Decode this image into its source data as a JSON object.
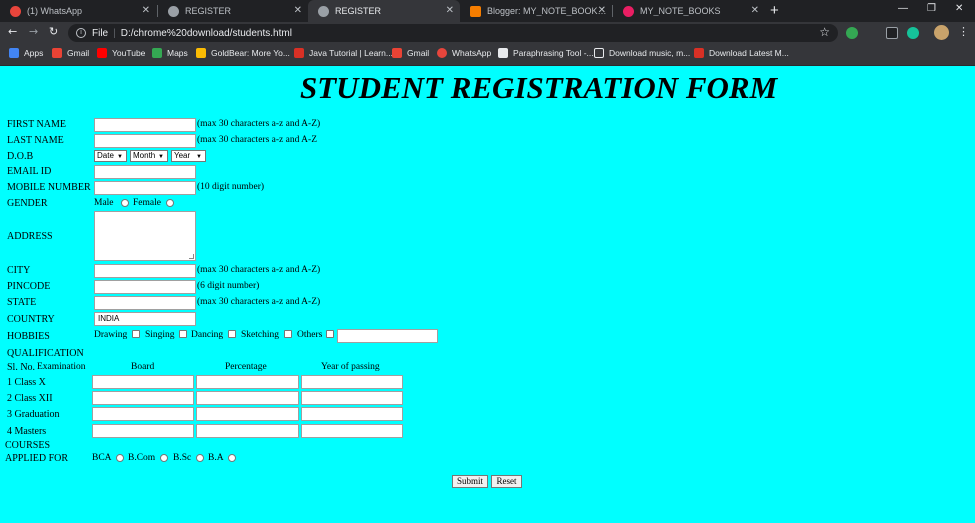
{
  "browser": {
    "tabs": [
      {
        "label": "(1) WhatsApp",
        "color": "#e8453c"
      },
      {
        "label": "REGISTER",
        "color": "#9aa0a6"
      },
      {
        "label": "REGISTER",
        "color": "#9aa0a6"
      },
      {
        "label": "Blogger: MY_NOTE_BOOKS - Ear",
        "color": "#f57d00"
      },
      {
        "label": "MY_NOTE_BOOKS",
        "color": "#e91e63"
      }
    ],
    "new_tab": "+",
    "address_scheme": "File",
    "address_url": "D:/chrome%20download/students.html",
    "bookmarks": [
      {
        "label": "Apps",
        "color": "#4285f4"
      },
      {
        "label": "Gmail",
        "color": "#ea4335"
      },
      {
        "label": "YouTube",
        "color": "#ff0000"
      },
      {
        "label": "Maps",
        "color": "#34a853"
      },
      {
        "label": "GoldBear: More Yo...",
        "color": "#fbbc04"
      },
      {
        "label": "Java Tutorial | Learn...",
        "color": "#d93025"
      },
      {
        "label": "Gmail",
        "color": "#ea4335"
      },
      {
        "label": "WhatsApp",
        "color": "#e8453c"
      },
      {
        "label": "Paraphrasing Tool -...",
        "color": "#e8eaed"
      },
      {
        "label": "Download music, m...",
        "color": "#e8eaed"
      },
      {
        "label": "Download Latest M...",
        "color": "#d93025"
      }
    ]
  },
  "form": {
    "title": "STUDENT REGISTRATION FORM",
    "fields": {
      "first_name": {
        "label": "FIRST NAME",
        "hint": "(max 30 characters a-z and A-Z)"
      },
      "last_name": {
        "label": "LAST NAME",
        "hint": "(max 30 characters a-z and A-Z"
      },
      "dob": {
        "label": "D.O.B",
        "date": "Date",
        "month": "Month",
        "year": "Year"
      },
      "email": {
        "label": "EMAIL ID"
      },
      "mobile": {
        "label": "MOBILE NUMBER",
        "hint": "(10 digit number)"
      },
      "gender": {
        "label": "GENDER",
        "male": "Male",
        "female": "Female"
      },
      "address": {
        "label": "ADDRESS"
      },
      "city": {
        "label": "CITY",
        "hint": "(max 30 characters a-z and A-Z)"
      },
      "pincode": {
        "label": "PINCODE",
        "hint": "(6 digit number)"
      },
      "state": {
        "label": "STATE",
        "hint": "(max 30 characters a-z and A-Z)"
      },
      "country": {
        "label": "COUNTRY",
        "value": "INDIA"
      },
      "hobbies": {
        "label": "HOBBIES",
        "options": [
          "Drawing",
          "Singing",
          "Dancing",
          "Sketching",
          "Others"
        ]
      }
    },
    "qualification": {
      "label": "QUALIFICATION",
      "headers": [
        "Sl. No.",
        "Examination",
        "Board",
        "Percentage",
        "Year of passing"
      ],
      "rows": [
        "1 Class X",
        "2 Class XII",
        "3 Graduation",
        "4 Masters"
      ]
    },
    "courses": {
      "label_line1": "COURSES",
      "label_line2": "APPLIED FOR",
      "options": [
        "BCA",
        "B.Com",
        "B.Sc",
        "B.A"
      ]
    },
    "buttons": {
      "submit": "Submit",
      "reset": "Reset"
    }
  }
}
